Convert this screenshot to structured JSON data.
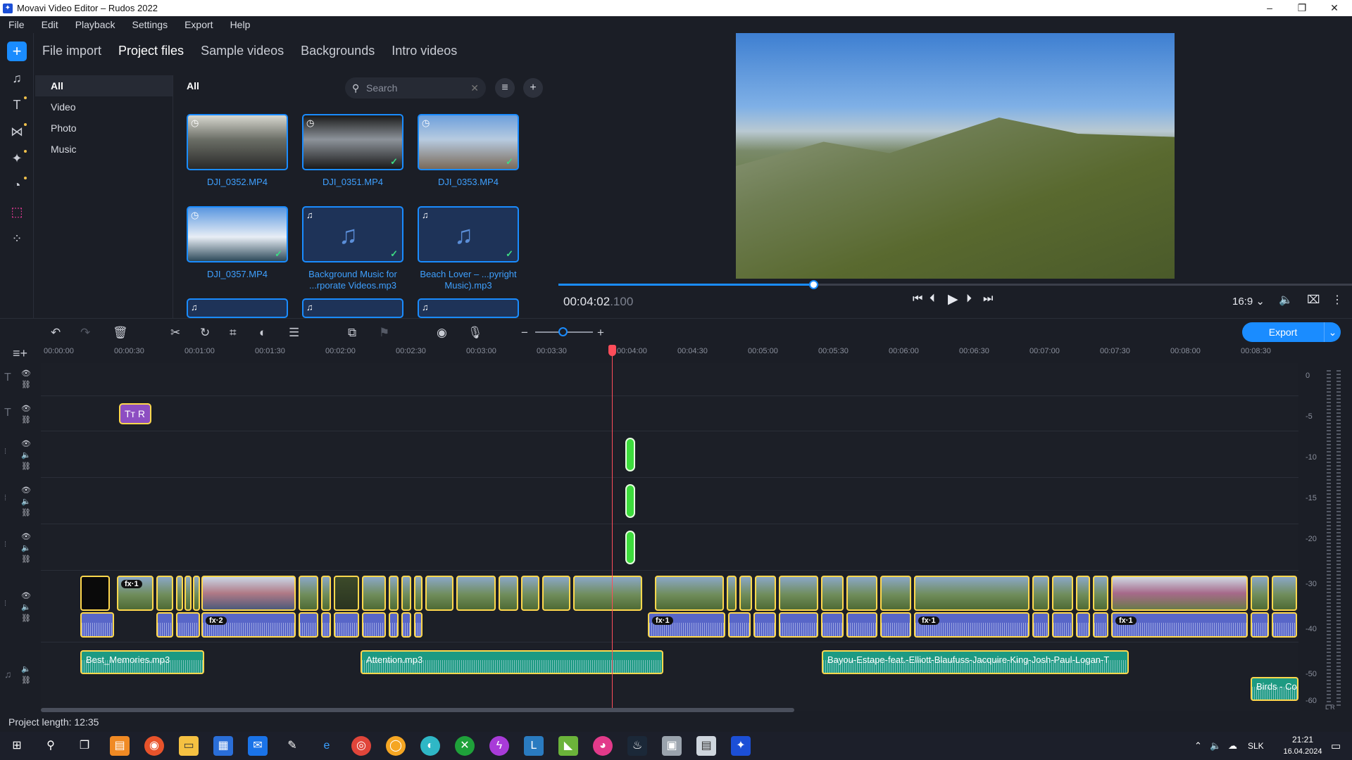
{
  "window": {
    "title": "Movavi Video Editor – Rudos 2022",
    "minimize": "–",
    "maximize": "❐",
    "close": "✕"
  },
  "menu": [
    "File",
    "Edit",
    "Playback",
    "Settings",
    "Export",
    "Help"
  ],
  "rail_icons": [
    "add-icon",
    "music-icon",
    "text-icon",
    "transitions-icon",
    "magic-icon",
    "clock-icon",
    "stickers-icon",
    "more-tools-icon"
  ],
  "media": {
    "tabs": [
      "File import",
      "Project files",
      "Sample videos",
      "Backgrounds",
      "Intro videos"
    ],
    "active_tab": "Project files",
    "categories": [
      "All",
      "Video",
      "Photo",
      "Music"
    ],
    "selected_category": "All",
    "section_title": "All",
    "search_placeholder": "Search",
    "files": [
      {
        "name": "DJI_0352.MP4",
        "kind": "video",
        "used": false
      },
      {
        "name": "DJI_0351.MP4",
        "kind": "video",
        "used": true
      },
      {
        "name": "DJI_0353.MP4",
        "kind": "video",
        "used": true
      },
      {
        "name": "DJI_0357.MP4",
        "kind": "video",
        "used": true
      },
      {
        "name": "Background Music for ...rporate Videos.mp3",
        "kind": "audio",
        "used": true
      },
      {
        "name": "Beach Lover – ...pyright Music).mp3",
        "kind": "audio",
        "used": true
      }
    ]
  },
  "preview": {
    "timecode": "00:04:02",
    "timecode_ms": ".100",
    "progress_fraction": 0.32,
    "aspect_ratio": "16:9 ⌄"
  },
  "toolbar": {
    "export_label": "Export",
    "zoom_fraction": 0.48
  },
  "timeline": {
    "ruler": [
      "00:00:00",
      "00:00:30",
      "00:01:00",
      "00:01:30",
      "00:02:00",
      "00:02:30",
      "00:03:00",
      "00:03:30",
      "00:04:00",
      "00:04:30",
      "00:05:00",
      "00:05:30",
      "00:06:00",
      "00:06:30",
      "00:07:00",
      "00:07:30",
      "00:08:00",
      "00:08:30"
    ],
    "title_clip_label": "Tт R",
    "video_fx": [
      "fx·1"
    ],
    "audio_fx": [
      "fx·2",
      "fx·1",
      "fx·1",
      "fx·1"
    ],
    "music_clips": [
      "Best_Memories.mp3",
      "Attention.mp3",
      "Bayou-Estape-feat.-Elliott-Blaufuss-Jacquire-King-Josh-Paul-Logan-T",
      "Birds - Co"
    ],
    "meter_labels": [
      "0",
      "-5",
      "-10",
      "-15",
      "-20",
      "-30",
      "-40",
      "-50",
      "-60"
    ],
    "meter_lr": "L R"
  },
  "status": {
    "project_length": "Project length: 12:35"
  },
  "taskbar": {
    "clock_time": "21:21",
    "clock_date": "16.04.2024",
    "language": "SLK"
  }
}
